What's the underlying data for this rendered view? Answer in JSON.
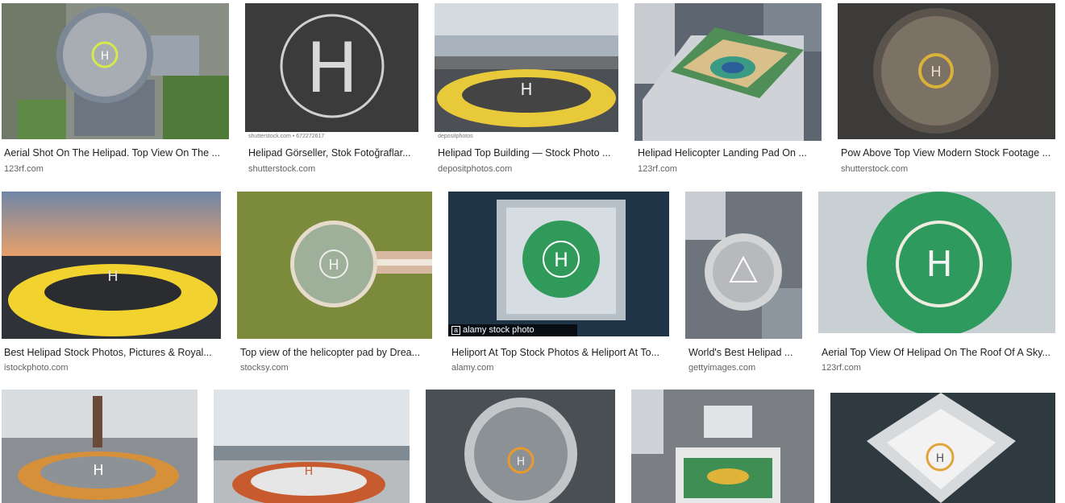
{
  "results": [
    {
      "title": "Aerial Shot On The Helipad. Top View On The ...",
      "source": "123rf.com",
      "thumb": "rooftop-round-helipad"
    },
    {
      "title": "Helipad Görseller, Stok Fotoğraflar...",
      "source": "shutterstock.com",
      "thumb": "asphalt-h-circle",
      "strip": "shutterstock.com • 672272617"
    },
    {
      "title": "Helipad Top Building — Stock Photo ...",
      "source": "depositphotos.com",
      "thumb": "yellow-ring-skyline",
      "strip": "depositphotos"
    },
    {
      "title": "Helipad Helicopter Landing Pad On ...",
      "source": "123rf.com",
      "thumb": "tower-roof-helipad"
    },
    {
      "title": "Pow Above Top View Modern Stock Footage ...",
      "source": "shutterstock.com",
      "thumb": "dark-round-helipad"
    },
    {
      "title": "Best Helipad Stock Photos, Pictures & Royal...",
      "source": "istockphoto.com",
      "thumb": "sunset-yellow-helipad"
    },
    {
      "title": "Top view of the helicopter pad by Drea...",
      "source": "stocksy.com",
      "thumb": "grass-helipad"
    },
    {
      "title": "Heliport At Top Stock Photos & Heliport At To...",
      "source": "alamy.com",
      "thumb": "green-square-helipad",
      "watermark": "alamy stock photo"
    },
    {
      "title": "World's Best Helipad ...",
      "source": "gettyimages.com",
      "thumb": "city-round-helipad"
    },
    {
      "title": "Aerial Top View Of Helipad On The Roof Of A Sky...",
      "source": "123rf.com",
      "thumb": "green-closeup-helipad"
    },
    {
      "title": "",
      "source": "",
      "thumb": "chimney-orange-helipad"
    },
    {
      "title": "",
      "source": "",
      "thumb": "red-ring-helipad"
    },
    {
      "title": "",
      "source": "",
      "thumb": "circular-building-helipad"
    },
    {
      "title": "",
      "source": "",
      "thumb": "green-rooftop-city"
    },
    {
      "title": "",
      "source": "",
      "thumb": "diamond-roof-helipad"
    }
  ]
}
